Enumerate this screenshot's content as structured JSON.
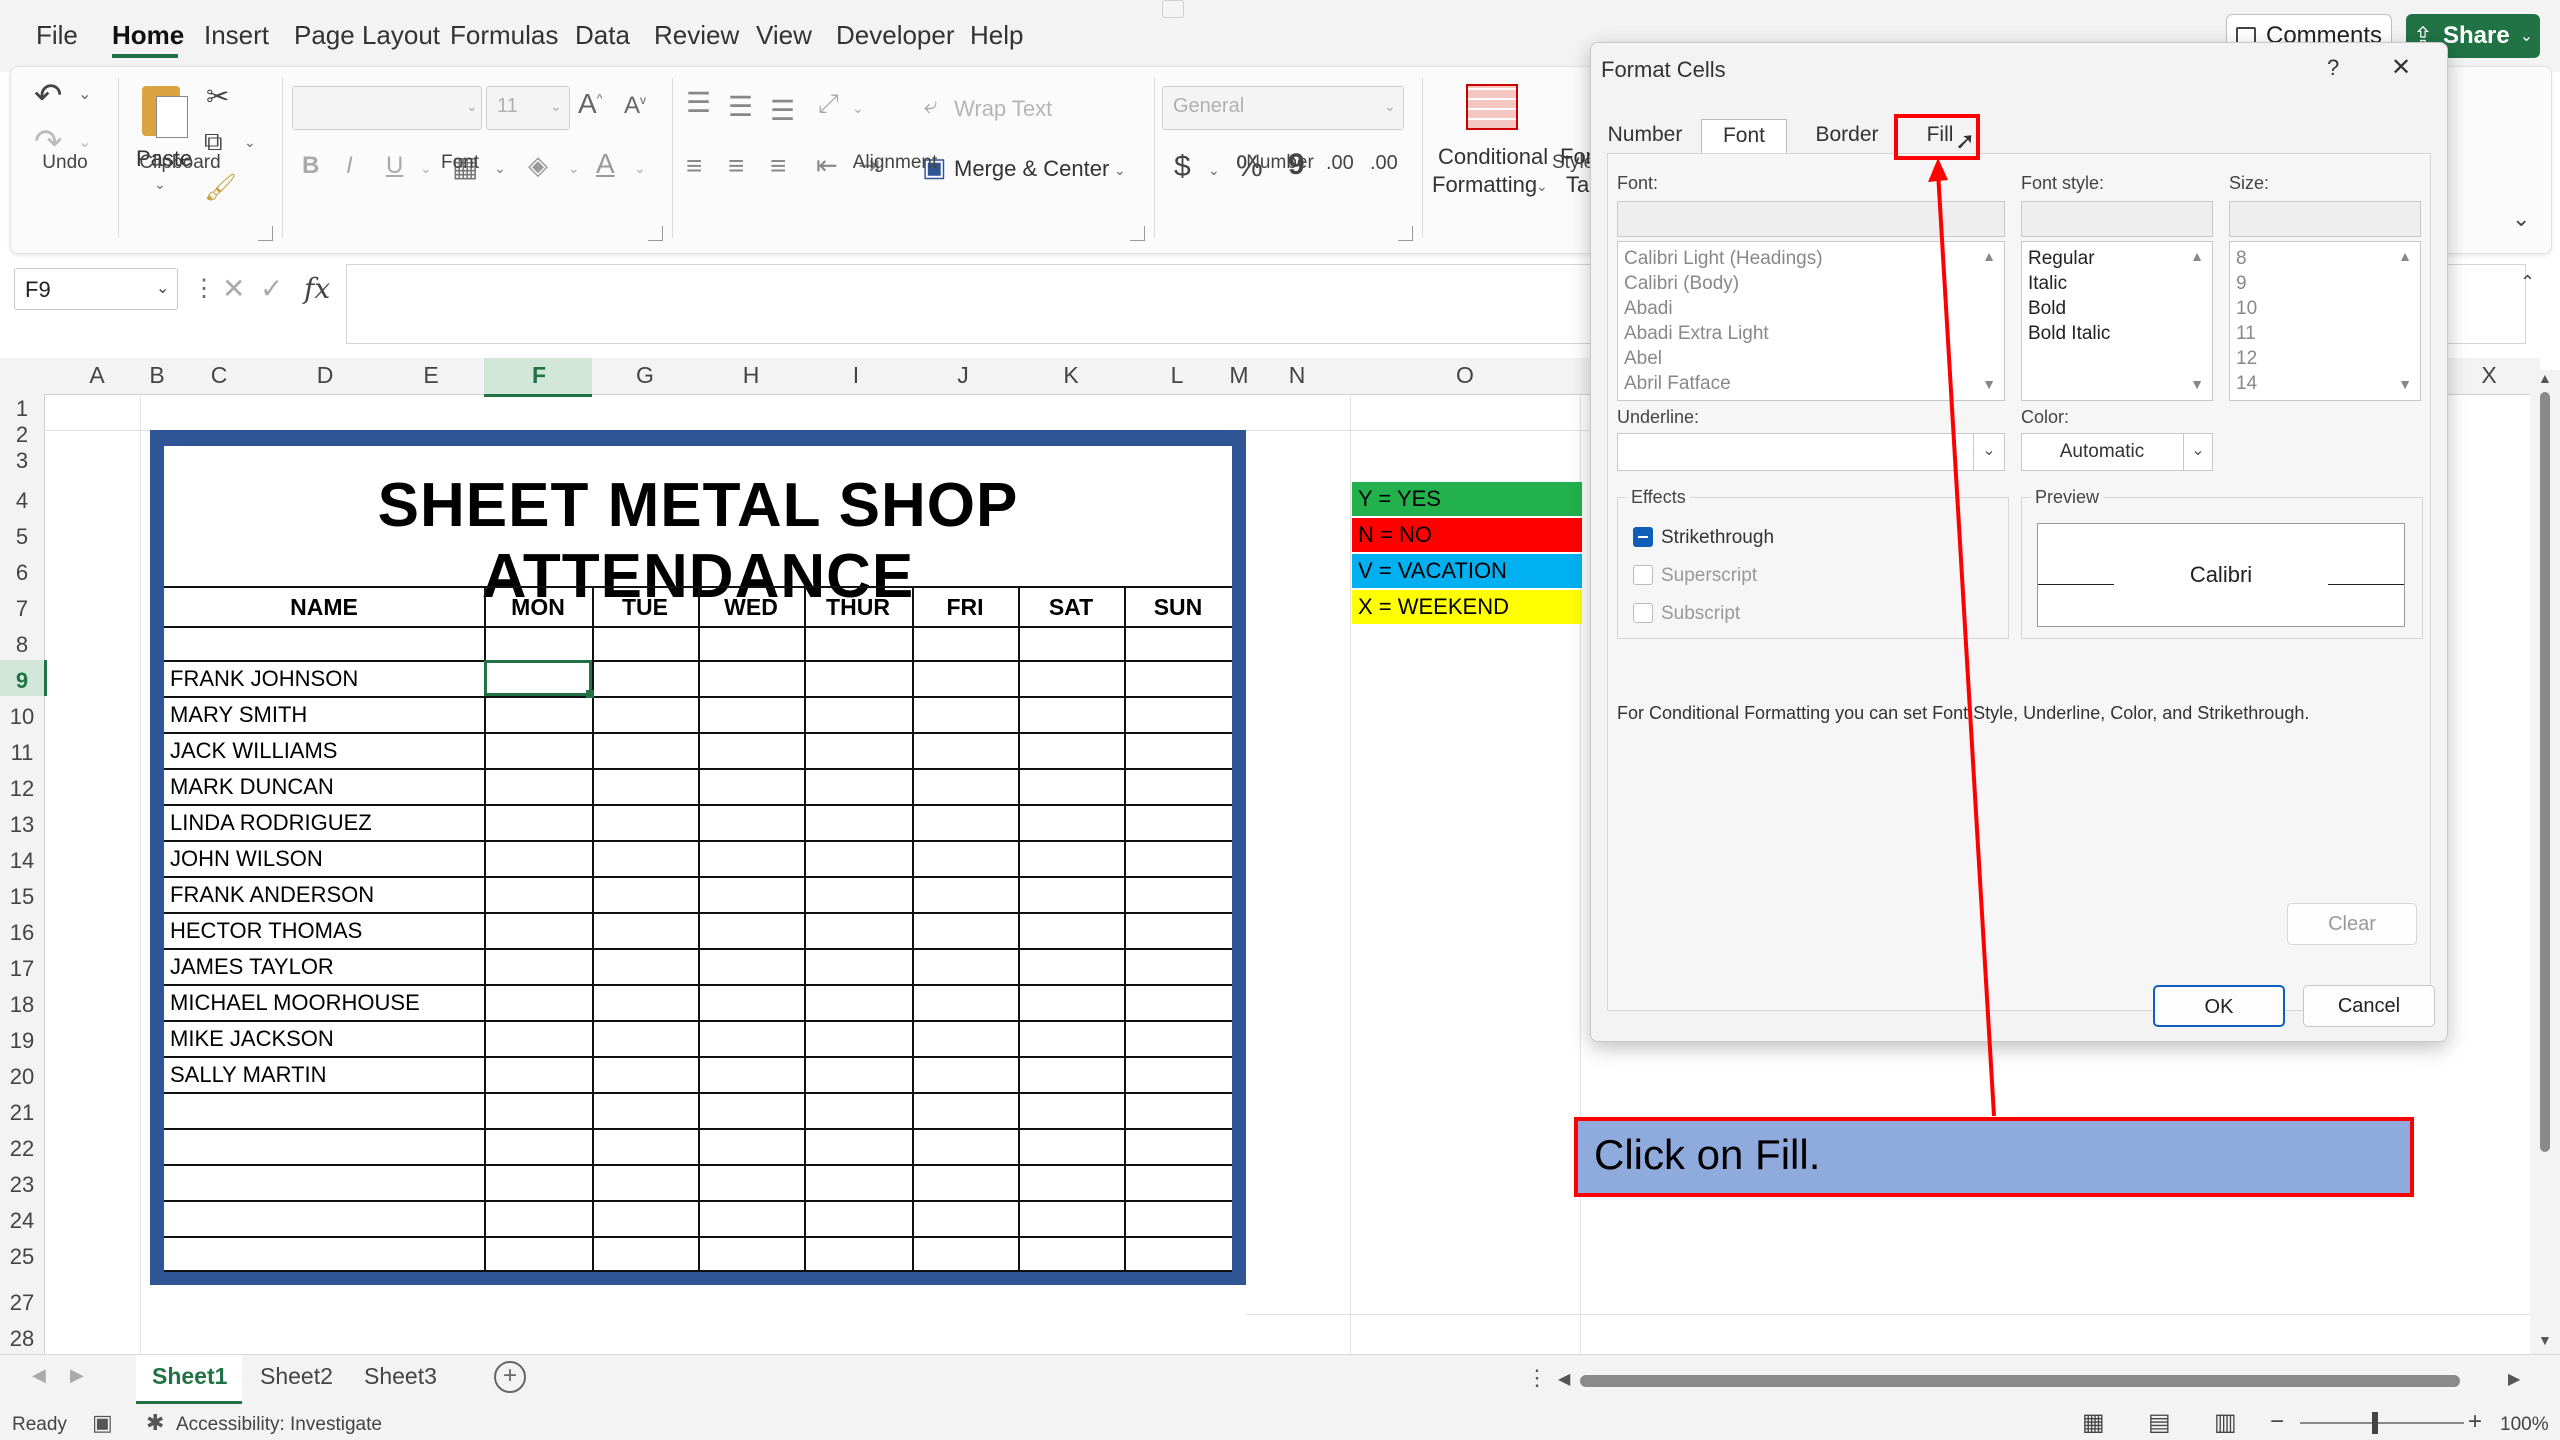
{
  "menu": {
    "items": [
      "File",
      "Home",
      "Insert",
      "Page Layout",
      "Formulas",
      "Data",
      "Review",
      "View",
      "Developer",
      "Help"
    ],
    "active": "Home",
    "comments_label": "Comments",
    "share_label": "Share"
  },
  "ribbon": {
    "groups": {
      "undo": "Undo",
      "clipboard": "Clipboard",
      "font": "Font",
      "alignment": "Alignment",
      "number": "Number",
      "styles": "Style"
    },
    "paste_label": "Paste",
    "font_size": "11",
    "wrap_text": "Wrap Text",
    "merge_center": "Merge & Center",
    "number_format": "General",
    "currency": "$",
    "percent": "%",
    "comma": "9",
    "inc_decimal": ".00",
    "dec_decimal": ".00",
    "conditional_formatting_line1": "Conditional",
    "conditional_formatting_line2": "Formatting",
    "format_as_table_line1": "For",
    "format_as_table_line2": "Ta"
  },
  "formula_bar": {
    "name_box": "F9",
    "fx": "fx",
    "value": ""
  },
  "grid": {
    "columns": [
      "A",
      "B",
      "C",
      "D",
      "E",
      "F",
      "G",
      "H",
      "I",
      "J",
      "K",
      "L",
      "M",
      "N",
      "O",
      "X"
    ],
    "selected_column": "F",
    "rows": [
      "1",
      "2",
      "3",
      "4",
      "5",
      "6",
      "7",
      "8",
      "9",
      "10",
      "11",
      "12",
      "13",
      "14",
      "15",
      "16",
      "17",
      "18",
      "19",
      "20",
      "21",
      "22",
      "23",
      "24",
      "25",
      "27",
      "28"
    ],
    "selected_row": "9"
  },
  "sheet": {
    "title": "SHEET METAL SHOP ATTENDANCE",
    "headers": [
      "NAME",
      "MON",
      "TUE",
      "WED",
      "THUR",
      "FRI",
      "SAT",
      "SUN"
    ],
    "names": [
      "FRANK JOHNSON",
      "MARY SMITH",
      "JACK WILLIAMS",
      "MARK DUNCAN",
      "LINDA RODRIGUEZ",
      "JOHN WILSON",
      "FRANK ANDERSON",
      "HECTOR THOMAS",
      "JAMES TAYLOR",
      "MICHAEL MOORHOUSE",
      "MIKE JACKSON",
      "SALLY MARTIN"
    ],
    "frame_color": "#2f5597"
  },
  "legend": [
    {
      "text": "Y = YES",
      "color": "#22b14c"
    },
    {
      "text": "N = NO",
      "color": "#ff0000"
    },
    {
      "text": "V = VACATION",
      "color": "#00b0f0"
    },
    {
      "text": "X = WEEKEND",
      "color": "#ffff00"
    }
  ],
  "dialog": {
    "title": "Format Cells",
    "help": "?",
    "close": "✕",
    "tabs": [
      "Number",
      "Font",
      "Border",
      "Fill"
    ],
    "active_tab": "Font",
    "font_label": "Font:",
    "font_style_label": "Font style:",
    "size_label": "Size:",
    "fonts": [
      "Calibri Light (Headings)",
      "Calibri (Body)",
      "Abadi",
      "Abadi Extra Light",
      "Abel",
      "Abril Fatface"
    ],
    "styles": [
      "Regular",
      "Italic",
      "Bold",
      "Bold Italic"
    ],
    "sizes": [
      "8",
      "9",
      "10",
      "11",
      "12",
      "14"
    ],
    "underline_label": "Underline:",
    "color_label": "Color:",
    "color_value": "Automatic",
    "effects_label": "Effects",
    "strikethrough": "Strikethrough",
    "superscript": "Superscript",
    "subscript": "Subscript",
    "preview_label": "Preview",
    "preview_text": "Calibri",
    "info": "For Conditional Formatting you can set Font Style, Underline, Color, and Strikethrough.",
    "clear": "Clear",
    "ok": "OK",
    "cancel": "Cancel"
  },
  "annotation": {
    "callout": "Click on Fill."
  },
  "sheet_tabs": [
    "Sheet1",
    "Sheet2",
    "Sheet3"
  ],
  "active_sheet": "Sheet1",
  "status": {
    "ready": "Ready",
    "accessibility": "Accessibility: Investigate",
    "zoom": "100%"
  },
  "colors": {
    "accent": "#217346",
    "highlight": "#ff0000",
    "callout_bg": "#8faadc"
  }
}
